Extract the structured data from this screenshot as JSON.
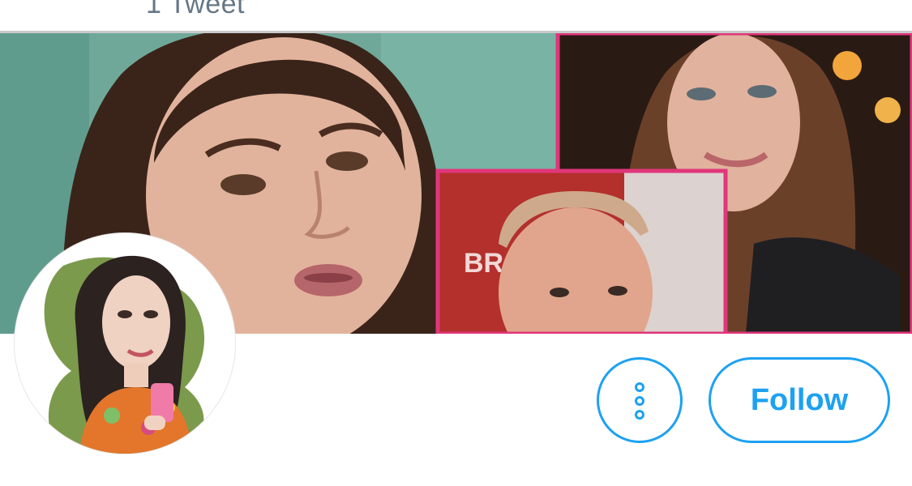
{
  "header": {
    "tweet_count": "1 Tweet"
  },
  "banner": {
    "image": "banner-collage-photo",
    "colors": {
      "frame": "#e0367b",
      "background": "#7fb6a6"
    }
  },
  "profile": {
    "avatar": "avatar-illustration"
  },
  "actions": {
    "more_icon": "more-vertical-icon",
    "follow_label": "Follow",
    "accent": "#1da1f2"
  }
}
